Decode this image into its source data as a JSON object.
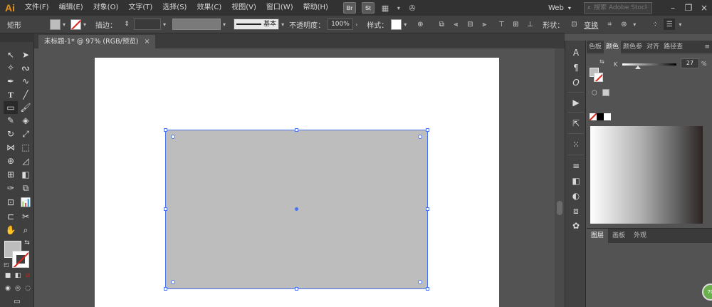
{
  "app": {
    "logo_text": "Ai",
    "menus": [
      "文件(F)",
      "编辑(E)",
      "对象(O)",
      "文字(T)",
      "选择(S)",
      "效果(C)",
      "视图(V)",
      "窗口(W)",
      "帮助(H)"
    ],
    "bridge_label": "Br",
    "stock_label": "St",
    "workspace": "Web",
    "search_placeholder": "搜索 Adobe Stock",
    "accent_color": "#4b73f0"
  },
  "control_bar": {
    "selection_label": "矩形",
    "stroke_label": "描边：",
    "stroke_style": "基本",
    "opacity_label": "不透明度：",
    "opacity_value": "100%",
    "style_label": "样式：",
    "shape_label": "形状：",
    "transform_label": "变换"
  },
  "document": {
    "tab_title": "未标题-1* @ 97% (RGB/预览)",
    "close_glyph": "×"
  },
  "canvas": {
    "shape_fill": "#bdbdbd",
    "selection_color": "#4b73f0"
  },
  "panels": {
    "color_tabs": [
      "色板",
      "颜色",
      "颜色参",
      "对齐",
      "路径查"
    ],
    "active_color_tab": "颜色",
    "k_label": "K",
    "k_value": "27",
    "k_unit": "%",
    "layer_tabs": [
      "图层",
      "画板",
      "外观"
    ],
    "badge_text": "70"
  }
}
